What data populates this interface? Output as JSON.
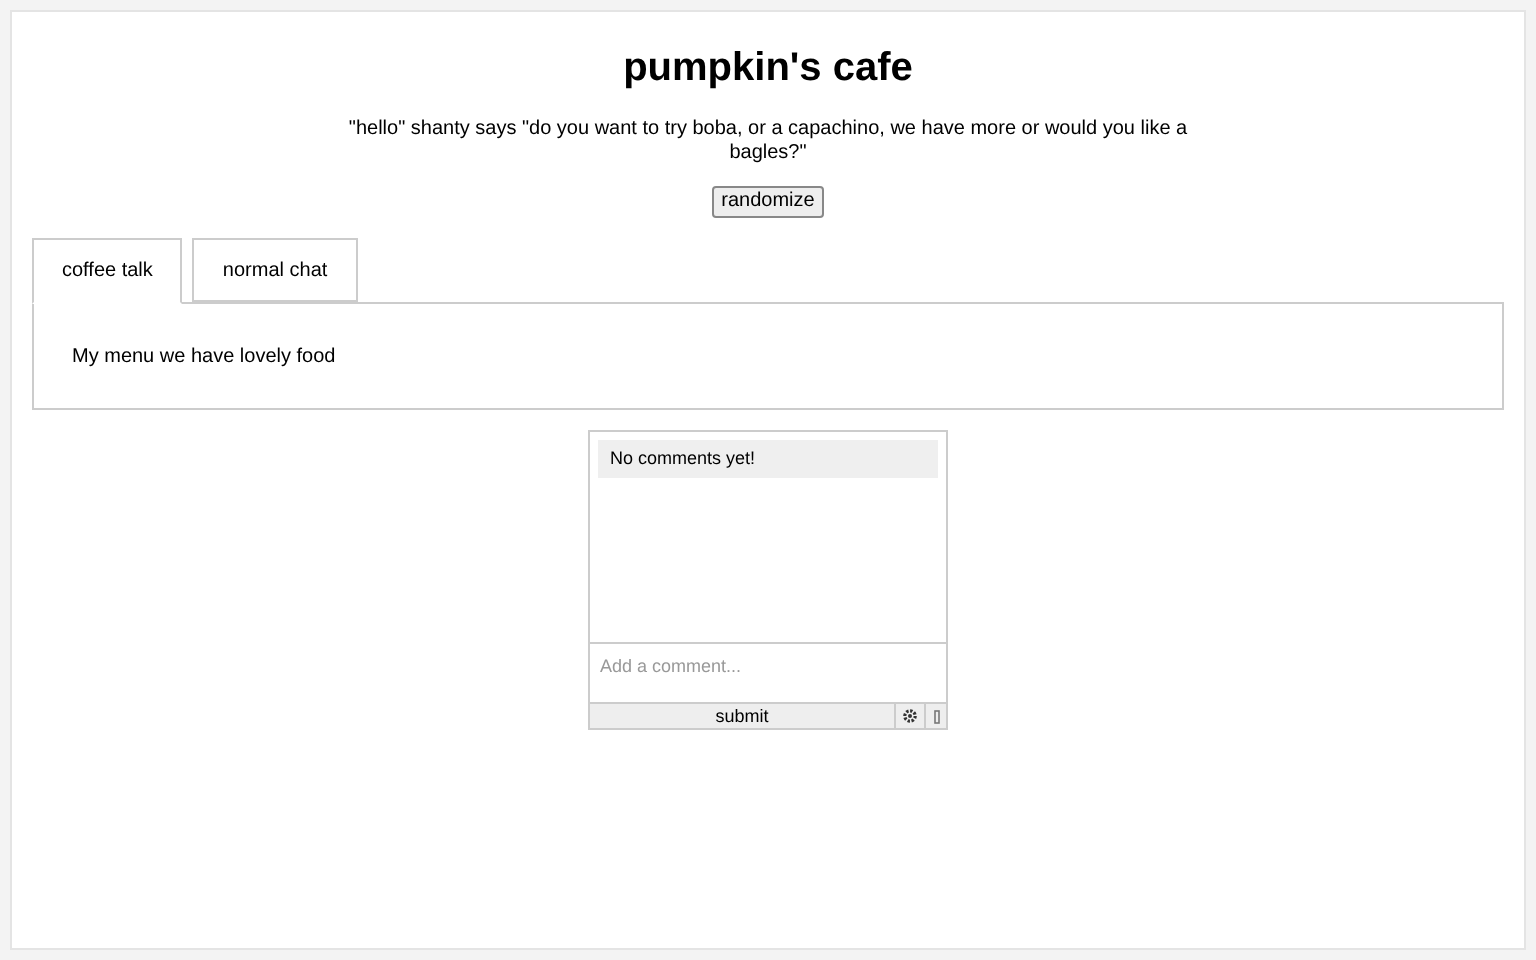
{
  "title": "pumpkin's cafe",
  "quote": "\"hello\" shanty says \"do you want to try boba, or a capachino, we have more or would you like a bagles?\"",
  "randomize_button": "randomize",
  "tabs": [
    {
      "label": "coffee talk",
      "selected": true
    },
    {
      "label": "normal chat",
      "selected": false
    }
  ],
  "tab_content": "My menu we have lovely food",
  "comments": {
    "empty_message": "No comments yet!",
    "placeholder": "Add a comment...",
    "submit": "submit"
  }
}
